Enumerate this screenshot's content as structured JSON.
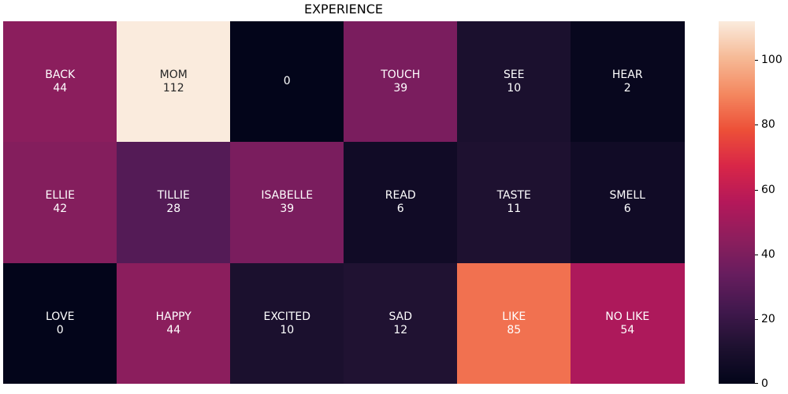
{
  "chart_data": {
    "type": "heatmap",
    "title": "EXPERIENCE",
    "rows": 3,
    "cols": 6,
    "cells": [
      {
        "label": "BACK",
        "value": 44
      },
      {
        "label": "MOM",
        "value": 112
      },
      {
        "label": "",
        "value": 0
      },
      {
        "label": "TOUCH",
        "value": 39
      },
      {
        "label": "SEE",
        "value": 10
      },
      {
        "label": "HEAR",
        "value": 2
      },
      {
        "label": "ELLIE",
        "value": 42
      },
      {
        "label": "TILLIE",
        "value": 28
      },
      {
        "label": "ISABELLE",
        "value": 39
      },
      {
        "label": "READ",
        "value": 6
      },
      {
        "label": "TASTE",
        "value": 11
      },
      {
        "label": "SMELL",
        "value": 6
      },
      {
        "label": "LOVE",
        "value": 0
      },
      {
        "label": "HAPPY",
        "value": 44
      },
      {
        "label": "EXCITED",
        "value": 10
      },
      {
        "label": "SAD",
        "value": 12
      },
      {
        "label": "LIKE",
        "value": 85
      },
      {
        "label": "NO LIKE",
        "value": 54
      }
    ],
    "colorbar": {
      "min": 0,
      "max": 112,
      "ticks": [
        0,
        20,
        40,
        60,
        80,
        100
      ],
      "colormap": "rocket"
    }
  }
}
